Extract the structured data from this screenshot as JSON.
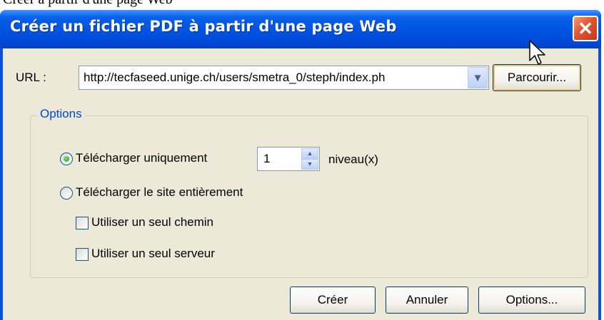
{
  "page_caption": "Créer à partir d'une page Web",
  "window": {
    "title": "Créer un fichier PDF à partir d'une page Web",
    "close_icon": "close-icon"
  },
  "url": {
    "label": "URL :",
    "value": "http://tecfaseed.unige.ch/users/smetra_0/steph/index.ph",
    "browse_label": "Parcourir..."
  },
  "options_group": {
    "title": "Options",
    "download_only": {
      "label": "Télécharger uniquement",
      "selected": true
    },
    "levels": {
      "value": "1",
      "unit": "niveau(x)"
    },
    "download_all": {
      "label": "Télécharger le site entièrement",
      "selected": false
    },
    "single_path": {
      "label": "Utiliser un seul chemin",
      "checked": false
    },
    "single_server": {
      "label": "Utiliser un seul serveur",
      "checked": false
    }
  },
  "buttons": {
    "create": "Créer",
    "cancel": "Annuler",
    "options": "Options..."
  }
}
